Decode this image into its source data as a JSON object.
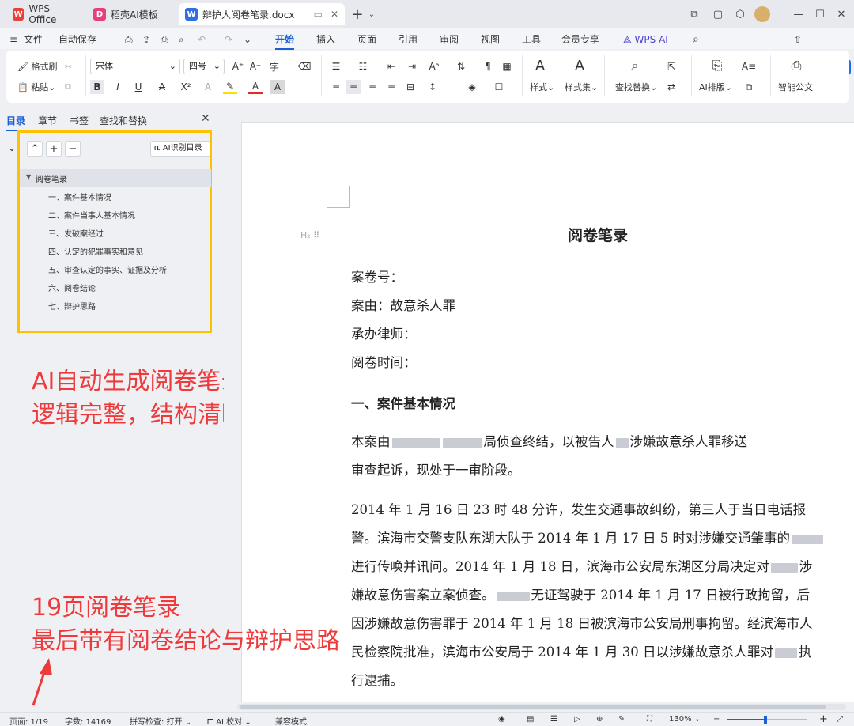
{
  "tabs": [
    {
      "label": "WPS Office"
    },
    {
      "label": "稻壳AI模板"
    },
    {
      "label": "辩护人阅卷笔录.docx"
    }
  ],
  "menu": {
    "file": "文件",
    "autosave": "自动保存",
    "items": [
      "开始",
      "插入",
      "页面",
      "引用",
      "审阅",
      "视图",
      "工具",
      "会员专享",
      "WPS AI"
    ],
    "share": "分享"
  },
  "ribbon": {
    "format_painter": "格式刷",
    "paste": "粘贴",
    "font": "宋体",
    "size": "四号",
    "styles": "样式",
    "style_set": "样式集",
    "find_replace": "查找替换",
    "ai_layout": "AI排版",
    "smart_doc": "智能公文"
  },
  "panel": {
    "tabs": [
      "目录",
      "章节",
      "书签",
      "查找和替换"
    ],
    "ai_toc_button": "AI识别目录",
    "toc_root": "阅卷笔录",
    "toc_items": [
      "一、案件基本情况",
      "二、案件当事人基本情况",
      "三、发破案经过",
      "四、认定的犯罪事实和意见",
      "五、审查认定的事实、证据及分析",
      "六、阅卷结论",
      "七、辩护思路"
    ]
  },
  "annotations": {
    "top_line1": "AI自动生成阅卷笔录",
    "top_line2": "逻辑完整，结构清晰",
    "bottom_line1": "19页阅卷笔录",
    "bottom_line2": "最后带有阅卷结论与辩护思路"
  },
  "document": {
    "title": "阅卷笔录",
    "fields": [
      "案卷号：",
      "案由：故意杀人罪",
      "承办律师：",
      "阅卷时间："
    ],
    "heading1": "一、案件基本情况",
    "p1_line1a": "本案由",
    "p1_line1b": "局侦查终结，以被告人",
    "p1_line1c": "涉嫌故意杀人罪移送",
    "p1_line2": "审查起诉，现处于一审阶段。",
    "p2_line1": "2014 年 1 月 16 日 23 时 48 分许，发生交通事故纠纷，第三人于当日电话报",
    "p2_line2": "警。滨海市交警支队东湖大队于 2014 年 1 月 17 日 5 时对涉嫌交通肇事的",
    "p2_line3a": "进行传唤并讯问。2014 年 1 月 18 日，滨海市公安局东湖区分局决定对",
    "p2_line3b": "涉",
    "p2_line4a": "嫌故意伤害案立案侦查。",
    "p2_line4b": "无证驾驶于 2014 年 1 月 17 日被行政拘留，后",
    "p2_line5": "因涉嫌故意伤害罪于 2014 年 1 月 18 日被滨海市公安局刑事拘留。经滨海市人",
    "p2_line6a": "民检察院批准，滨海市公安局于 2014 年 1 月 30 日以涉嫌故意杀人罪对",
    "p2_line6b": "执",
    "p2_line7": "行逮捕。"
  },
  "status": {
    "page": "页面: 1/19",
    "words": "字数: 14169",
    "spell": "拼写检查: 打开",
    "ai_check": "AI 校对",
    "compat": "兼容模式",
    "zoom": "130%"
  },
  "colors": {
    "accent": "#1a5fd6",
    "highlight_box": "#ffc000",
    "annotation": "#ee3a3a"
  }
}
